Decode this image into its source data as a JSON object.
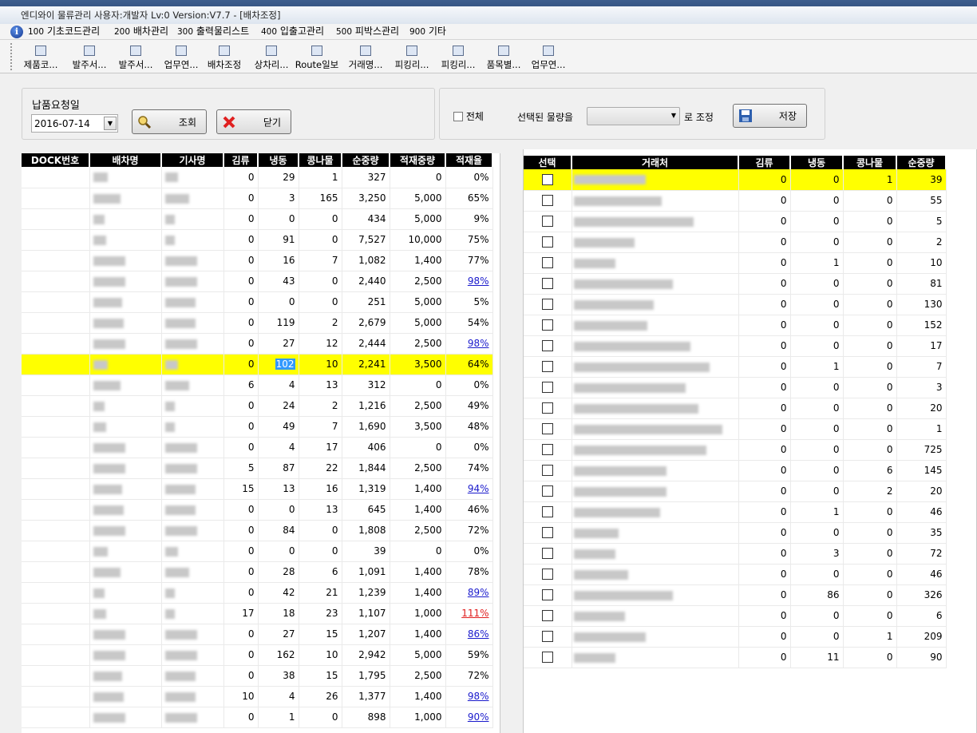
{
  "window": {
    "title": "엔디와이 물류관리 사용자:개발자 Lv:0  Version:V7.7 - [배차조정]"
  },
  "menu": [
    {
      "num": "100",
      "label": "기초코드관리"
    },
    {
      "num": "200",
      "label": "배차관리"
    },
    {
      "num": "300",
      "label": "출력물리스트"
    },
    {
      "num": "400",
      "label": "입출고관리"
    },
    {
      "num": "500",
      "label": "피박스관리"
    },
    {
      "num": "900",
      "label": "기타"
    }
  ],
  "toolbar": [
    {
      "label": "제품코...",
      "icon": "product-code-icon"
    },
    {
      "label": "발주서...",
      "icon": "folder-icon"
    },
    {
      "label": "발주서...",
      "icon": "order-copy-icon"
    },
    {
      "label": "업무연...",
      "icon": "users-icon"
    },
    {
      "label": "배차조정",
      "icon": "search-globe-icon"
    },
    {
      "label": "상차리...",
      "icon": "grid-icon"
    },
    {
      "label": "Route일보",
      "icon": "grid-icon"
    },
    {
      "label": "거래명...",
      "icon": "check-doc-icon"
    },
    {
      "label": "피킹리...",
      "icon": "list-doc-icon"
    },
    {
      "label": "피킹리...",
      "icon": "list-doc-icon"
    },
    {
      "label": "품목별...",
      "icon": "grid-icon"
    },
    {
      "label": "업무연...",
      "icon": "phone-icon"
    }
  ],
  "filter": {
    "date_label": "납품요청일",
    "date_value": "2016-07-14",
    "search_label": "조회",
    "close_label": "닫기"
  },
  "adjust": {
    "all_label": "전체",
    "selected_label": "선택된 물량을",
    "to_label": "로 조정",
    "save_label": "저장",
    "combo_value": ""
  },
  "left_table": {
    "headers": [
      "DOCK번호",
      "배차명",
      "기사명",
      "김류",
      "냉동",
      "콩나물",
      "순중량",
      "적재중량",
      "적재율"
    ],
    "rows": [
      [
        "",
        "",
        "",
        "0",
        "29",
        "1",
        "327",
        "0",
        "0%"
      ],
      [
        "",
        "",
        "",
        "0",
        "3",
        "165",
        "3,250",
        "5,000",
        "65%"
      ],
      [
        "",
        "",
        "",
        "0",
        "0",
        "0",
        "434",
        "5,000",
        "9%"
      ],
      [
        "",
        "",
        "",
        "0",
        "91",
        "0",
        "7,527",
        "10,000",
        "75%"
      ],
      [
        "",
        "",
        "",
        "0",
        "16",
        "7",
        "1,082",
        "1,400",
        "77%"
      ],
      [
        "",
        "",
        "",
        "0",
        "43",
        "0",
        "2,440",
        "2,500",
        "98%"
      ],
      [
        "",
        "",
        "",
        "0",
        "0",
        "0",
        "251",
        "5,000",
        "5%"
      ],
      [
        "",
        "",
        "",
        "0",
        "119",
        "2",
        "2,679",
        "5,000",
        "54%"
      ],
      [
        "",
        "",
        "",
        "0",
        "27",
        "12",
        "2,444",
        "2,500",
        "98%"
      ],
      [
        "",
        "",
        "",
        "0",
        "102",
        "10",
        "2,241",
        "3,500",
        "64%"
      ],
      [
        "",
        "",
        "",
        "6",
        "4",
        "13",
        "312",
        "0",
        "0%"
      ],
      [
        "",
        "",
        "",
        "0",
        "24",
        "2",
        "1,216",
        "2,500",
        "49%"
      ],
      [
        "",
        "",
        "",
        "0",
        "49",
        "7",
        "1,690",
        "3,500",
        "48%"
      ],
      [
        "",
        "",
        "",
        "0",
        "4",
        "17",
        "406",
        "0",
        "0%"
      ],
      [
        "",
        "",
        "",
        "5",
        "87",
        "22",
        "1,844",
        "2,500",
        "74%"
      ],
      [
        "",
        "",
        "",
        "15",
        "13",
        "16",
        "1,319",
        "1,400",
        "94%"
      ],
      [
        "",
        "",
        "",
        "0",
        "0",
        "13",
        "645",
        "1,400",
        "46%"
      ],
      [
        "",
        "",
        "",
        "0",
        "84",
        "0",
        "1,808",
        "2,500",
        "72%"
      ],
      [
        "",
        "",
        "",
        "0",
        "0",
        "0",
        "39",
        "0",
        "0%"
      ],
      [
        "",
        "",
        "",
        "0",
        "28",
        "6",
        "1,091",
        "1,400",
        "78%"
      ],
      [
        "",
        "",
        "",
        "0",
        "42",
        "21",
        "1,239",
        "1,400",
        "89%"
      ],
      [
        "",
        "",
        "",
        "17",
        "18",
        "23",
        "1,107",
        "1,000",
        "111%"
      ],
      [
        "",
        "",
        "",
        "0",
        "27",
        "15",
        "1,207",
        "1,400",
        "86%"
      ],
      [
        "",
        "",
        "",
        "0",
        "162",
        "10",
        "2,942",
        "5,000",
        "59%"
      ],
      [
        "",
        "",
        "",
        "0",
        "38",
        "15",
        "1,795",
        "2,500",
        "72%"
      ],
      [
        "",
        "",
        "",
        "10",
        "4",
        "26",
        "1,377",
        "1,400",
        "98%"
      ],
      [
        "",
        "",
        "",
        "0",
        "1",
        "0",
        "898",
        "1,000",
        "90%"
      ]
    ],
    "rate_styles": [
      "",
      "",
      "",
      "",
      "",
      "blue",
      "",
      "",
      "blue",
      "",
      "",
      "",
      "",
      "",
      "",
      "blue",
      "",
      "",
      "",
      "",
      "blue",
      "red",
      "blue",
      "",
      "",
      "blue",
      "blue"
    ],
    "highlight_row": 9
  },
  "right_table": {
    "headers": [
      "선택",
      "거래처",
      "김류",
      "냉동",
      "콩나물",
      "순중량"
    ],
    "rows": [
      [
        "",
        "0",
        "0",
        "1",
        "39"
      ],
      [
        "",
        "0",
        "0",
        "0",
        "55"
      ],
      [
        "",
        "0",
        "0",
        "0",
        "5"
      ],
      [
        "",
        "0",
        "0",
        "0",
        "2"
      ],
      [
        "",
        "0",
        "1",
        "0",
        "10"
      ],
      [
        "",
        "0",
        "0",
        "0",
        "81"
      ],
      [
        "",
        "0",
        "0",
        "0",
        "130"
      ],
      [
        "",
        "0",
        "0",
        "0",
        "152"
      ],
      [
        "",
        "0",
        "0",
        "0",
        "17"
      ],
      [
        "",
        "0",
        "1",
        "0",
        "7"
      ],
      [
        "",
        "0",
        "0",
        "0",
        "3"
      ],
      [
        "",
        "0",
        "0",
        "0",
        "20"
      ],
      [
        "",
        "0",
        "0",
        "0",
        "1"
      ],
      [
        "",
        "0",
        "0",
        "0",
        "725"
      ],
      [
        "",
        "0",
        "0",
        "6",
        "145"
      ],
      [
        "",
        "0",
        "0",
        "2",
        "20"
      ],
      [
        "",
        "0",
        "1",
        "0",
        "46"
      ],
      [
        "",
        "0",
        "0",
        "0",
        "35"
      ],
      [
        "",
        "0",
        "3",
        "0",
        "72"
      ],
      [
        "",
        "0",
        "0",
        "0",
        "46"
      ],
      [
        "",
        "0",
        "86",
        "0",
        "326"
      ],
      [
        "",
        "0",
        "0",
        "0",
        "6"
      ],
      [
        "",
        "0",
        "0",
        "1",
        "209"
      ],
      [
        "",
        "0",
        "11",
        "0",
        "90"
      ]
    ],
    "highlight_row": 0
  }
}
